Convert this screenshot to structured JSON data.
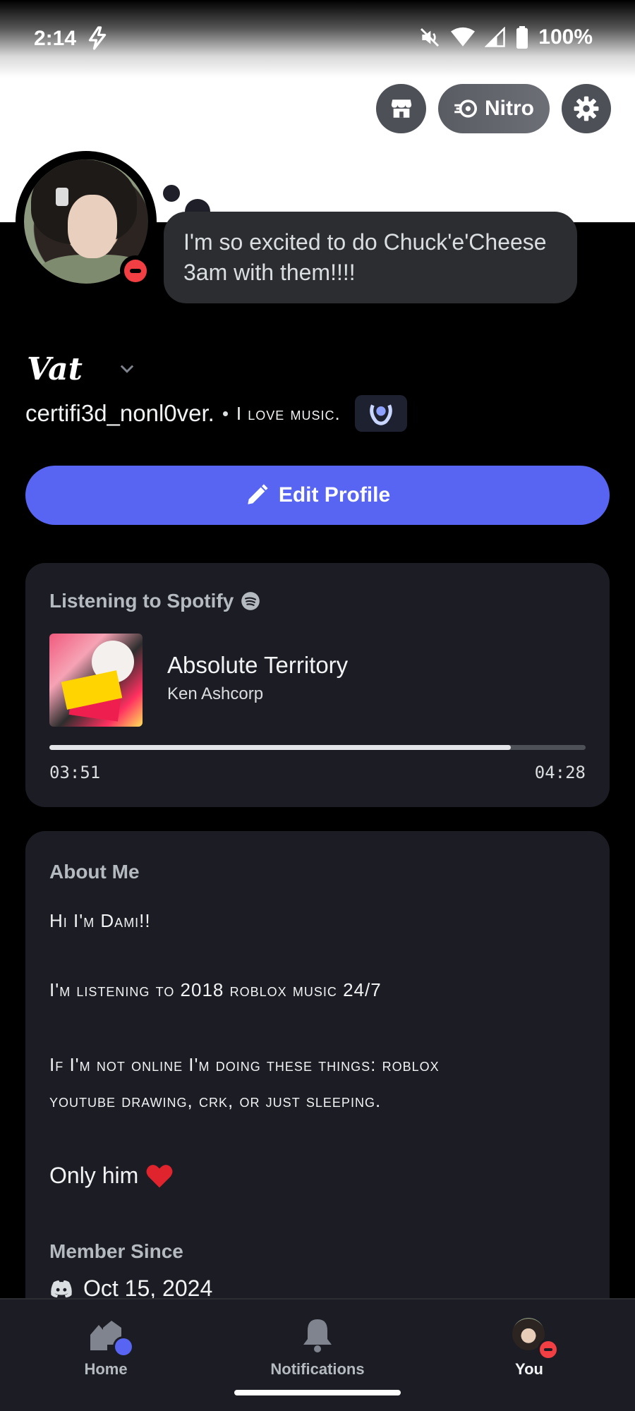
{
  "status_bar": {
    "time": "2:14",
    "battery": "100%"
  },
  "header": {
    "nitro_label": "Nitro"
  },
  "profile": {
    "custom_status": "I'm so excited to do Chuck'e'Cheese 3am with them!!!!",
    "display_name": "Vat",
    "username": "certifi3d_nonl0ver.",
    "pronouns": "I love music.",
    "status": "dnd",
    "edit_button_label": "Edit Profile"
  },
  "activity": {
    "title": "Listening to Spotify",
    "song": "Absolute Territory",
    "artist": "Ken Ashcorp",
    "elapsed": "03:51",
    "duration": "04:28",
    "progress_fraction": 0.86
  },
  "about": {
    "title": "About Me",
    "lines": [
      "Hi I'm Dami!!",
      "I'm listening to 2018 roblox music 24/7",
      "If I'm not online I'm doing these things: roblox",
      "youtube drawing, crk, or just sleeping."
    ],
    "only_him": "Only him",
    "member_since_title": "Member Since",
    "member_since_date": "Oct 15, 2024"
  },
  "nav": {
    "home": "Home",
    "notifications": "Notifications",
    "you": "You"
  },
  "colors": {
    "accent": "#5865f2",
    "dnd": "#f23f43",
    "card": "#1c1d24"
  },
  "icons": [
    "lightning-icon",
    "mute-icon",
    "wifi-icon",
    "signal-icon",
    "battery-icon",
    "shop-icon",
    "nitro-icon",
    "gear-icon",
    "chevron-down-icon",
    "badge-icon",
    "pencil-icon",
    "spotify-icon",
    "heart-icon",
    "discord-icon",
    "home-icon",
    "bell-icon"
  ]
}
